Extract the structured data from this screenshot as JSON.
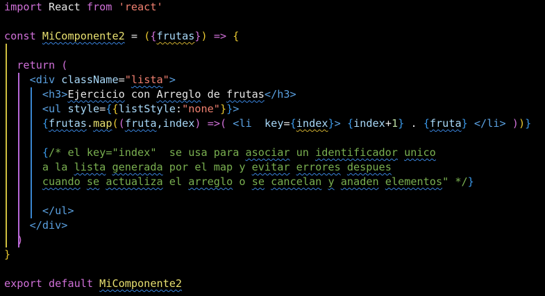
{
  "editor": {
    "lines": [
      [
        {
          "t": "import ",
          "c": "kw"
        },
        {
          "t": "React",
          "c": "plain"
        },
        {
          "t": " from ",
          "c": "kw"
        },
        {
          "t": "'react'",
          "c": "str"
        }
      ],
      [],
      [
        {
          "t": "const ",
          "c": "kw"
        },
        {
          "t": "MiComponente2",
          "c": "fn",
          "u": "b"
        },
        {
          "t": " = ",
          "c": "op"
        },
        {
          "t": "(",
          "c": "b1"
        },
        {
          "t": "{",
          "c": "b2"
        },
        {
          "t": "frutas",
          "c": "var",
          "u": "y"
        },
        {
          "t": "}",
          "c": "b2"
        },
        {
          "t": ")",
          "c": "b1"
        },
        {
          "t": " => ",
          "c": "kw"
        },
        {
          "t": "{",
          "c": "b1"
        }
      ],
      [],
      [
        {
          "t": "  return ",
          "c": "kw"
        },
        {
          "t": "(",
          "c": "b2"
        }
      ],
      [
        {
          "t": "    <",
          "c": "tag"
        },
        {
          "t": "div",
          "c": "tag"
        },
        {
          "t": " className",
          "c": "attr"
        },
        {
          "t": "=",
          "c": "op"
        },
        {
          "t": "\"",
          "c": "str"
        },
        {
          "t": "lista",
          "c": "str",
          "u": "b"
        },
        {
          "t": "\"",
          "c": "str"
        },
        {
          "t": ">",
          "c": "tag"
        }
      ],
      [
        {
          "t": "      <h3>",
          "c": "tag"
        },
        {
          "t": "Ejercicio",
          "c": "txt",
          "u": "b"
        },
        {
          "t": " con ",
          "c": "txt"
        },
        {
          "t": "Arreglo",
          "c": "txt",
          "u": "b"
        },
        {
          "t": " de ",
          "c": "txt"
        },
        {
          "t": "frutas",
          "c": "txt",
          "u": "b"
        },
        {
          "t": "</h3>",
          "c": "tag"
        }
      ],
      [
        {
          "t": "      <ul ",
          "c": "tag"
        },
        {
          "t": "style",
          "c": "attr"
        },
        {
          "t": "=",
          "c": "op"
        },
        {
          "t": "{",
          "c": "b3"
        },
        {
          "t": "{",
          "c": "b1"
        },
        {
          "t": "listStyle",
          "c": "var"
        },
        {
          "t": ":",
          "c": "op"
        },
        {
          "t": "\"none\"",
          "c": "str"
        },
        {
          "t": "}",
          "c": "b1"
        },
        {
          "t": "}",
          "c": "b3"
        },
        {
          "t": ">",
          "c": "tag"
        }
      ],
      [
        {
          "t": "      ",
          "c": "plain"
        },
        {
          "t": "{",
          "c": "b3"
        },
        {
          "t": "frutas",
          "c": "var",
          "u": "b"
        },
        {
          "t": ".",
          "c": "op"
        },
        {
          "t": "map",
          "c": "fn",
          "u": "b"
        },
        {
          "t": "(",
          "c": "b1"
        },
        {
          "t": "(",
          "c": "b2"
        },
        {
          "t": "fruta",
          "c": "var",
          "u": "b"
        },
        {
          "t": ",index",
          "c": "var"
        },
        {
          "t": ")",
          "c": "b2"
        },
        {
          "t": " =>",
          "c": "kw"
        },
        {
          "t": "(",
          "c": "b2"
        },
        {
          "t": " <li  ",
          "c": "tag"
        },
        {
          "t": "key",
          "c": "attr"
        },
        {
          "t": "=",
          "c": "op"
        },
        {
          "t": "{",
          "c": "b3"
        },
        {
          "t": "index",
          "c": "var",
          "u": "y"
        },
        {
          "t": "}",
          "c": "b3"
        },
        {
          "t": "> ",
          "c": "tag"
        },
        {
          "t": "{",
          "c": "b3"
        },
        {
          "t": "index",
          "c": "var"
        },
        {
          "t": "+",
          "c": "op"
        },
        {
          "t": "1",
          "c": "num"
        },
        {
          "t": "}",
          "c": "b3"
        },
        {
          "t": " . ",
          "c": "txt"
        },
        {
          "t": "{",
          "c": "b3"
        },
        {
          "t": "fruta",
          "c": "var",
          "u": "b"
        },
        {
          "t": "}",
          "c": "b3"
        },
        {
          "t": " </li> ",
          "c": "tag"
        },
        {
          "t": ")",
          "c": "b2"
        },
        {
          "t": ")",
          "c": "b1"
        },
        {
          "t": "}",
          "c": "b3"
        }
      ],
      [],
      [
        {
          "t": "      ",
          "c": "plain"
        },
        {
          "t": "{",
          "c": "b3"
        },
        {
          "t": "/* el key=\"index\"  se usa para ",
          "c": "cm"
        },
        {
          "t": "asociar",
          "c": "cm",
          "u": "b"
        },
        {
          "t": " un ",
          "c": "cm"
        },
        {
          "t": "identificador",
          "c": "cm",
          "u": "b"
        },
        {
          "t": " ",
          "c": "cm"
        },
        {
          "t": "unico",
          "c": "cm",
          "u": "b"
        }
      ],
      [
        {
          "t": "      a la ",
          "c": "cm"
        },
        {
          "t": "lista",
          "c": "cm",
          "u": "b"
        },
        {
          "t": " ",
          "c": "cm"
        },
        {
          "t": "generada",
          "c": "cm",
          "u": "b"
        },
        {
          "t": " por el map y ",
          "c": "cm"
        },
        {
          "t": "evitar",
          "c": "cm",
          "u": "b"
        },
        {
          "t": " ",
          "c": "cm"
        },
        {
          "t": "errores",
          "c": "cm",
          "u": "b"
        },
        {
          "t": " ",
          "c": "cm"
        },
        {
          "t": "despues",
          "c": "cm",
          "u": "b"
        }
      ],
      [
        {
          "t": "      ",
          "c": "cm"
        },
        {
          "t": "cuando",
          "c": "cm",
          "u": "b"
        },
        {
          "t": " ",
          "c": "cm"
        },
        {
          "t": "se",
          "c": "cm",
          "u": "b"
        },
        {
          "t": " ",
          "c": "cm"
        },
        {
          "t": "actualiza",
          "c": "cm",
          "u": "b"
        },
        {
          "t": " el ",
          "c": "cm"
        },
        {
          "t": "arreglo",
          "c": "cm",
          "u": "b"
        },
        {
          "t": " o ",
          "c": "cm"
        },
        {
          "t": "se",
          "c": "cm",
          "u": "b"
        },
        {
          "t": " ",
          "c": "cm"
        },
        {
          "t": "cancelan",
          "c": "cm",
          "u": "b"
        },
        {
          "t": " ",
          "c": "cm"
        },
        {
          "t": "y",
          "c": "cm",
          "u": "b"
        },
        {
          "t": " ",
          "c": "cm"
        },
        {
          "t": "anaden",
          "c": "cm",
          "u": "b"
        },
        {
          "t": " ",
          "c": "cm"
        },
        {
          "t": "elementos",
          "c": "cm",
          "u": "b"
        },
        {
          "t": "\" */",
          "c": "cm"
        },
        {
          "t": "}",
          "c": "b3"
        }
      ],
      [],
      [
        {
          "t": "      </ul>",
          "c": "tag"
        }
      ],
      [
        {
          "t": "    </div>",
          "c": "tag"
        }
      ],
      [
        {
          "t": "  ",
          "c": "plain"
        },
        {
          "t": ")",
          "c": "b2"
        }
      ],
      [
        {
          "t": "}",
          "c": "b1"
        }
      ],
      [],
      [
        {
          "t": "export ",
          "c": "kw"
        },
        {
          "t": "default ",
          "c": "kw"
        },
        {
          "t": "MiComponente2",
          "c": "fn",
          "u": "b"
        }
      ]
    ],
    "colors": {
      "background": "#000000",
      "keyword": "#d070d8",
      "string": "#f08070",
      "comment": "#7ab050",
      "tag": "#5aa0e0",
      "squiggle_blue": "#3a86e0",
      "squiggle_yellow": "#d0b030"
    }
  }
}
